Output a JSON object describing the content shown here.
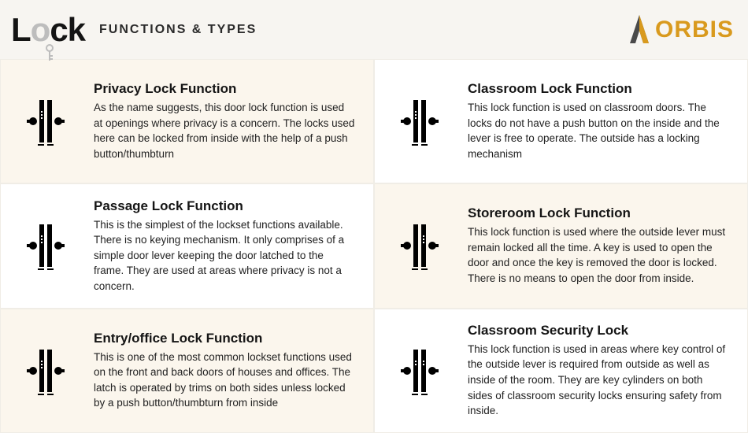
{
  "header": {
    "logo_word_prefix": "L",
    "logo_word_o": "o",
    "logo_word_suffix": "ck",
    "subtitle": "FUNCTIONS & TYPES",
    "brand": "ORBIS"
  },
  "cells": [
    {
      "title": "Privacy Lock Function",
      "desc": "As the name suggests, this door lock function is used at openings where privacy is a concern. The locks used here can be locked from inside with the help of a push button/thumbturn"
    },
    {
      "title": "Classroom Lock Function",
      "desc": "This lock function is used on classroom doors. The locks do not have a push button on the inside and the lever is free to operate. The outside has a locking mechanism"
    },
    {
      "title": "Passage Lock Function",
      "desc": "This is the simplest of the lockset functions available. There is no keying mechanism. It only comprises of a simple door lever keeping the door latched to the frame. They are used at areas where privacy is not a concern."
    },
    {
      "title": "Storeroom Lock Function",
      "desc": "This lock function is used where the outside lever must remain locked all the time. A key is used to open the door and once the key is removed the door is locked. There is no means to open the door from inside."
    },
    {
      "title": "Entry/office Lock Function",
      "desc": "This is one of the most common lockset functions used on the front and back doors of houses and offices. The latch is operated by trims on both sides unless locked by a push button/thumbturn from inside"
    },
    {
      "title": "Classroom Security Lock",
      "desc": "This lock function is used in areas where key control of the outside lever is required from outside as well as inside of the room. They are key cylinders on both sides of classroom security locks ensuring safety from inside."
    }
  ]
}
